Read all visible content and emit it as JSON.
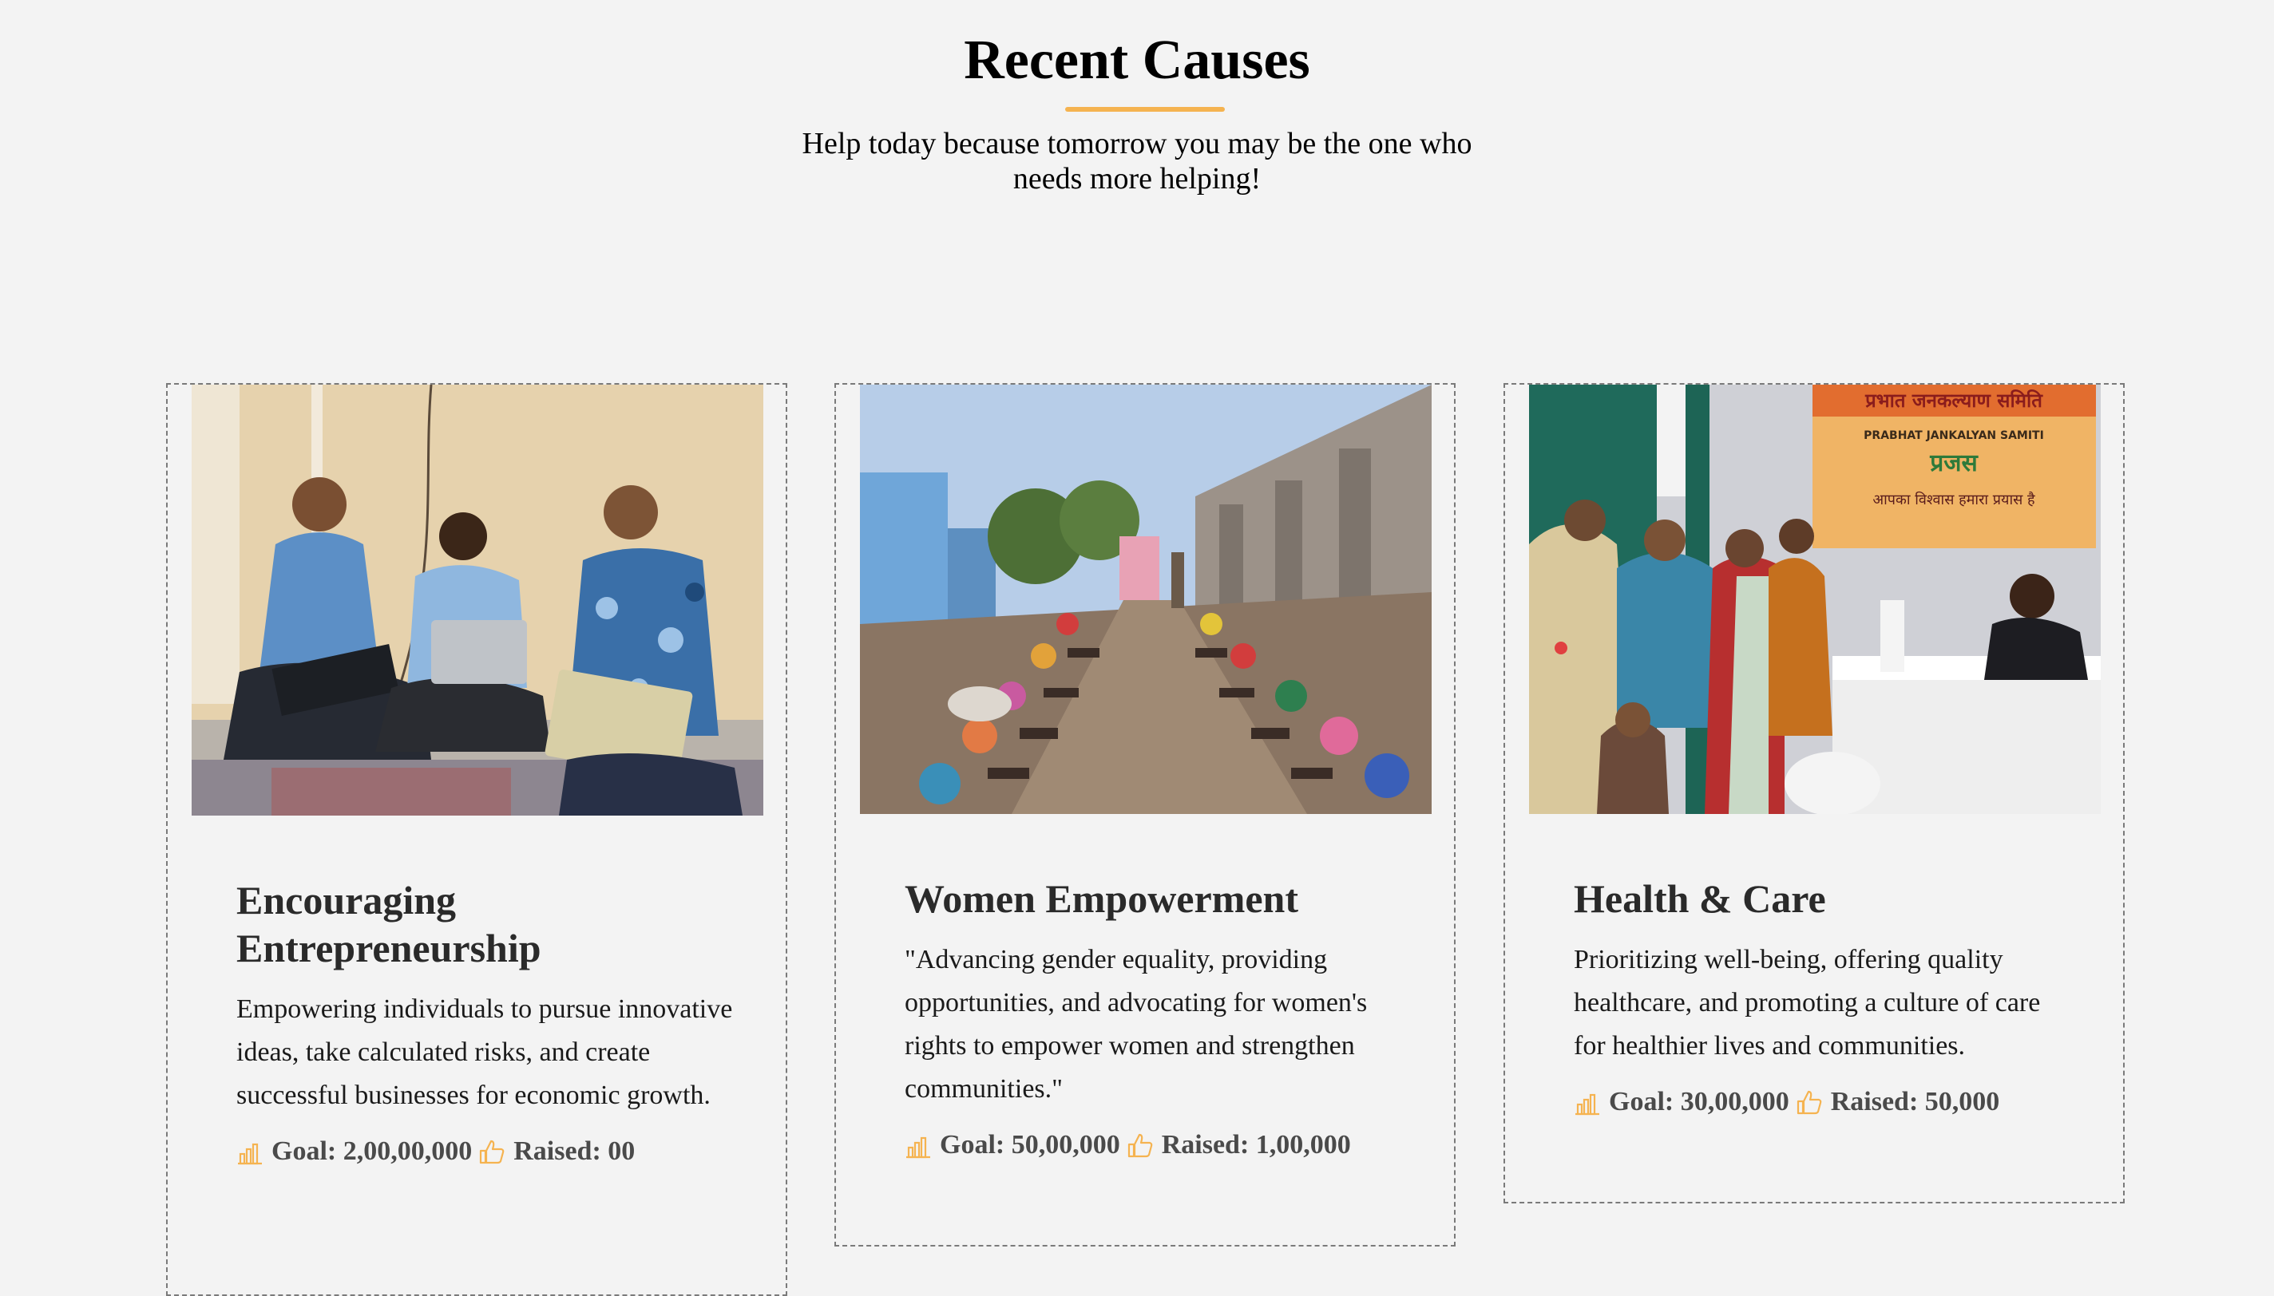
{
  "section": {
    "title": "Recent Causes",
    "subtitle": "Help today because tomorrow you may be the one who needs more helping!"
  },
  "colors": {
    "accent": "#f5b350",
    "background": "#f3f3f3",
    "border": "#7a7a7a"
  },
  "icons": {
    "goal": "bar-chart-icon",
    "raised": "thumbs-up-icon"
  },
  "causes": [
    {
      "image": "three-young-men-with-laptops-photo",
      "title": "Encouraging Entrepreneurship",
      "description": "Empowering individuals to pursue innovative ideas, take calculated risks, and create successful businesses for economic growth.",
      "goal": "Goal: 2,00,00,000",
      "raised": "Raised: 00"
    },
    {
      "image": "village-women-working-in-rows-photo",
      "title": "Women Empowerment",
      "description": "\"Advancing gender equality, providing opportunities, and advocating for women's rights to empower women and strengthen communities.\"",
      "goal": "Goal: 50,00,000",
      "raised": "Raised: 1,00,000"
    },
    {
      "image": "women-at-health-camp-photo",
      "title": "Health & Care",
      "description": "Prioritizing well-being, offering quality healthcare, and promoting a culture of care for healthier lives and communities.",
      "goal": "Goal: 30,00,000",
      "raised": "Raised: 50,000",
      "image_banner": {
        "line1": "प्रभात जनकल्याण समिति",
        "line2": "PRABHAT JANKALYAN SAMITI",
        "line3": "प्रजस",
        "line4": "आपका विश्वास हमारा प्रयास है"
      }
    }
  ]
}
